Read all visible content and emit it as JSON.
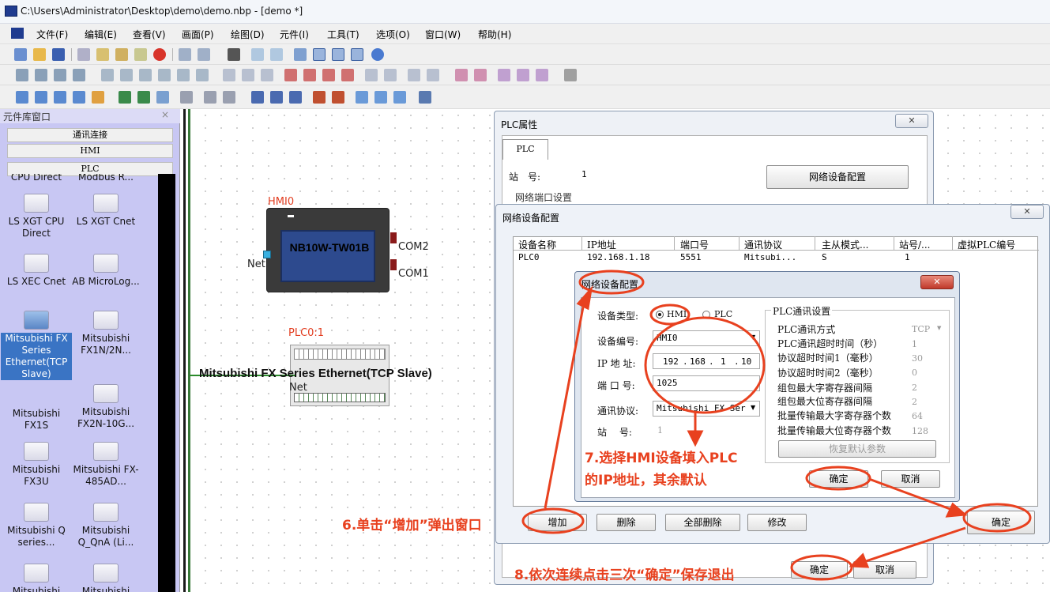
{
  "window": {
    "title": "C:\\Users\\Administrator\\Desktop\\demo\\demo.nbp - [demo *]"
  },
  "menu": [
    "文件(F)",
    "编辑(E)",
    "查看(V)",
    "画面(P)",
    "绘图(D)",
    "元件(I)",
    "工具(T)",
    "选项(O)",
    "窗口(W)",
    "帮助(H)"
  ],
  "library": {
    "title": "元件库窗口",
    "close": "×",
    "tabs": [
      "通讯连接",
      "HMI",
      "PLC"
    ],
    "items": [
      "CPU Direct",
      "Modbus R...",
      "LS XGT CPU Direct",
      "LS XGT Cnet",
      "LS XEC Cnet",
      "AB MicroLog...",
      "Mitsubishi FX Series Ethernet(TCP Slave)",
      "Mitsubishi FX1N/2N...",
      "Mitsubishi FX1S",
      "Mitsubishi FX2N-10G...",
      "Mitsubishi FX3U",
      "Mitsubishi FX-485AD...",
      "Mitsubishi Q series...",
      "Mitsubishi Q_QnA (Li...",
      "Mitsubishi",
      "Mitsubishi"
    ]
  },
  "canvas": {
    "hmi_label": "HMI0",
    "hmi_model": "NB10W-TW01B",
    "hmi_port1": "COM2",
    "hmi_port2": "COM1",
    "hmi_net": "Net",
    "plc_label": "PLC0:1",
    "plc_name": "Mitsubishi FX Series Ethernet(TCP Slave)",
    "plc_net": "Net"
  },
  "plc_props": {
    "title": "PLC属性",
    "close": "✕",
    "tab": "PLC",
    "station_label": "站　号:",
    "station_value": "1",
    "net_config_button": "网络设备配置",
    "port_group": "网络端口设置"
  },
  "net_config": {
    "title": "网络设备配置",
    "close": "✕",
    "columns": [
      "设备名称",
      "IP地址",
      "端口号",
      "通讯协议",
      "主从模式...",
      "站号/...",
      "虚拟PLC编号"
    ],
    "rows": [
      [
        "PLC0",
        "192.168.1.18",
        "5551",
        "Mitsubi...",
        "S",
        "1",
        ""
      ]
    ],
    "buttons": {
      "add": "增加",
      "delete": "删除",
      "delete_all": "全部删除",
      "modify": "修改",
      "ok": "确定",
      "ok_outer": "确定",
      "cancel_outer": "取消"
    }
  },
  "inner_dialog": {
    "title": "网络设备配置",
    "close": "✕",
    "device_type_label": "设备类型:",
    "radio_hmi": "HMI",
    "radio_plc": "PLC",
    "device_no_label": "设备编号:",
    "device_no_value": "HMI0",
    "ip_label": "IP 地 址:",
    "ip": [
      "192",
      "168",
      "1",
      "10"
    ],
    "port_label": "端 口 号:",
    "port_value": "1025",
    "protocol_label": "通讯协议:",
    "protocol_value": "Mitsubishi FX Ser",
    "station_label": "站　 号:",
    "station_value": "1",
    "plc_group": "PLC通讯设置",
    "plc_settings": [
      {
        "label": "PLC通讯方式",
        "value": "TCP"
      },
      {
        "label": "PLC通讯超时时间（秒）",
        "value": "1"
      },
      {
        "label": "协议超时时间1（毫秒）",
        "value": "30"
      },
      {
        "label": "协议超时时间2（毫秒）",
        "value": "0"
      },
      {
        "label": "组包最大字寄存器间隔",
        "value": "2"
      },
      {
        "label": "组包最大位寄存器间隔",
        "value": "2"
      },
      {
        "label": "批量传输最大字寄存器个数",
        "value": "64"
      },
      {
        "label": "批量传输最大位寄存器个数",
        "value": "128"
      }
    ],
    "restore_button": "恢复默认参数",
    "ok": "确定",
    "cancel": "取消"
  },
  "annotations": {
    "step6": "6.单击“增加”弹出窗口",
    "step7_line1": "7.选择HMI设备填入PLC",
    "step7_line2": "的IP地址，其余默认",
    "step8": "8.依次连续点击三次“确定”保存退出"
  },
  "colors": {
    "annotation": "#e8411f",
    "library_bg": "#c8c7f3",
    "selected": "#3a74c4"
  }
}
